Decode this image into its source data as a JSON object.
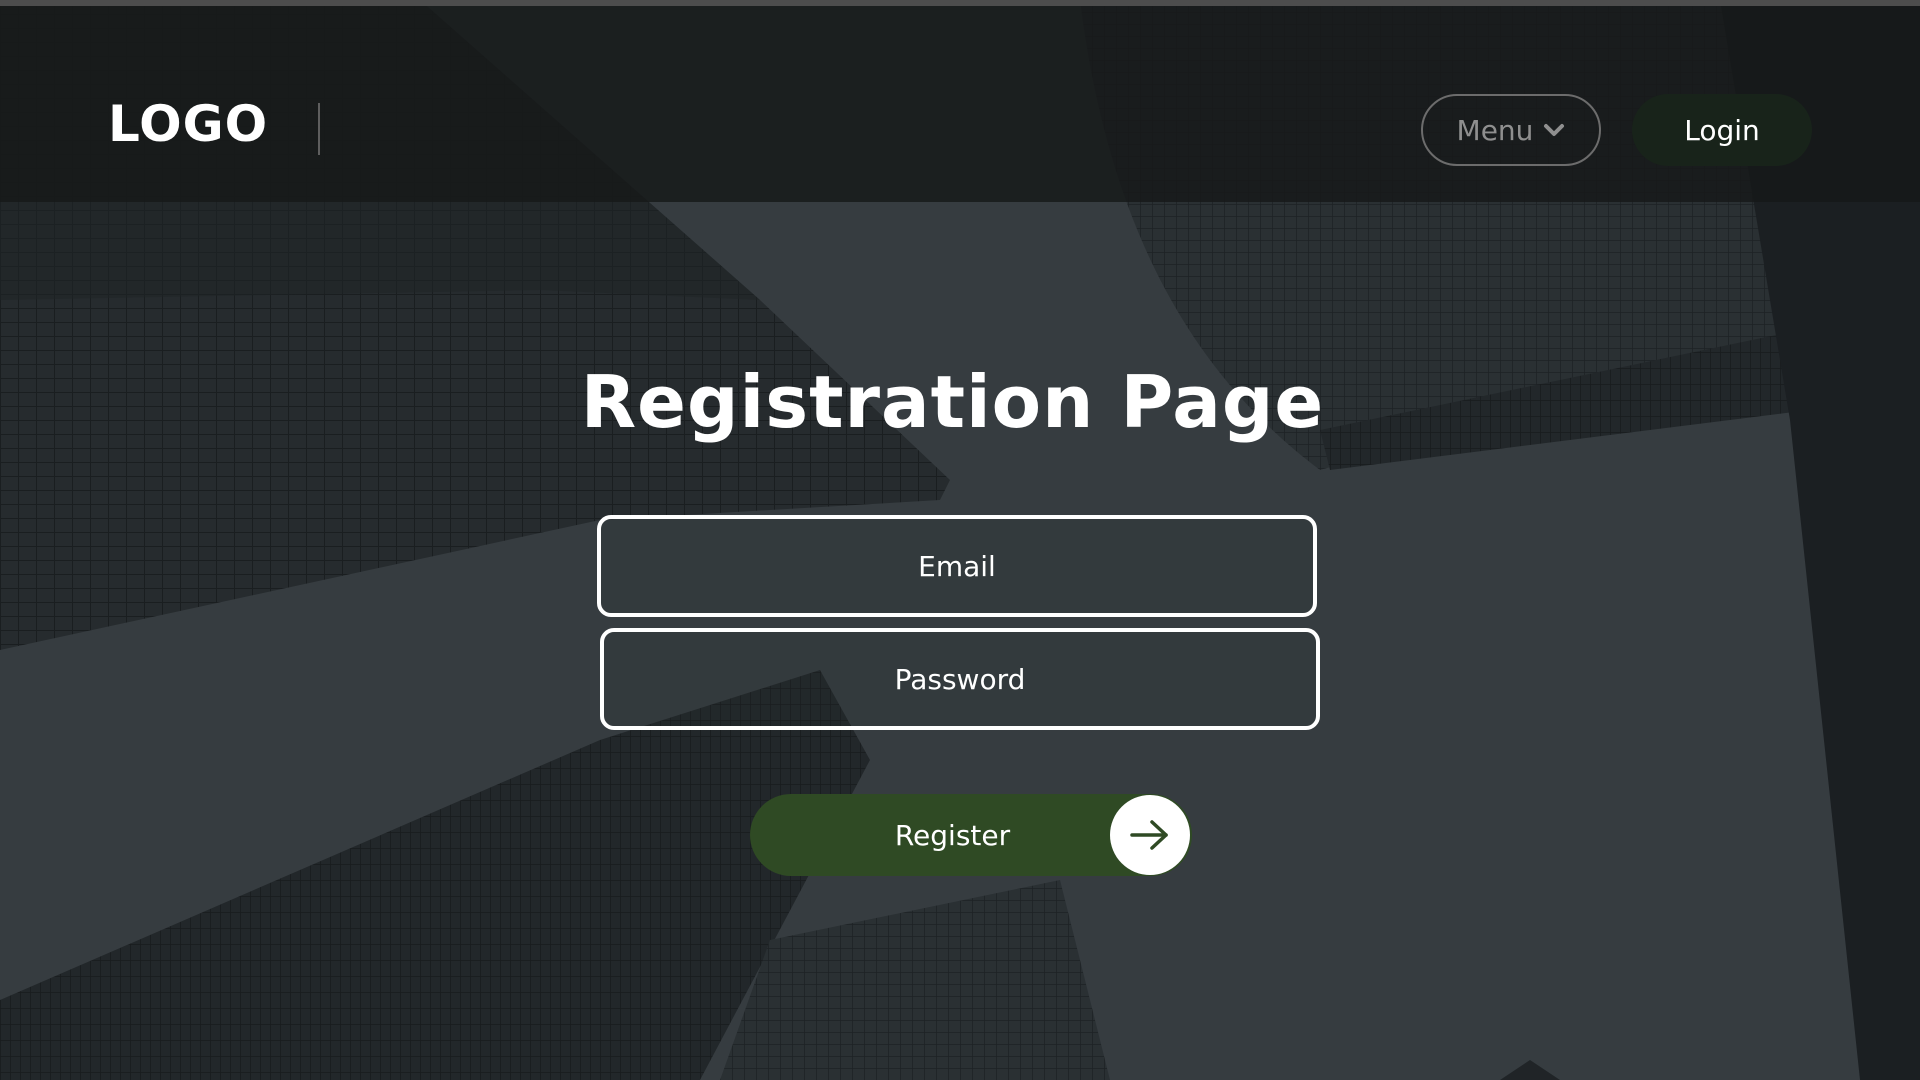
{
  "header": {
    "logo": "LOGO",
    "menu_label": "Menu",
    "menu_icon": "chevron-down-icon",
    "login_label": "Login"
  },
  "main": {
    "title": "Registration Page",
    "email_placeholder": "Email",
    "password_placeholder": "Password",
    "register_label": "Register",
    "register_icon": "arrow-right-icon"
  },
  "colors": {
    "header_bg": "#161819",
    "login_bg": "#18231a",
    "register_bg": "#2f4a24",
    "text": "#ffffff",
    "menu_text": "#8f8f8f"
  }
}
